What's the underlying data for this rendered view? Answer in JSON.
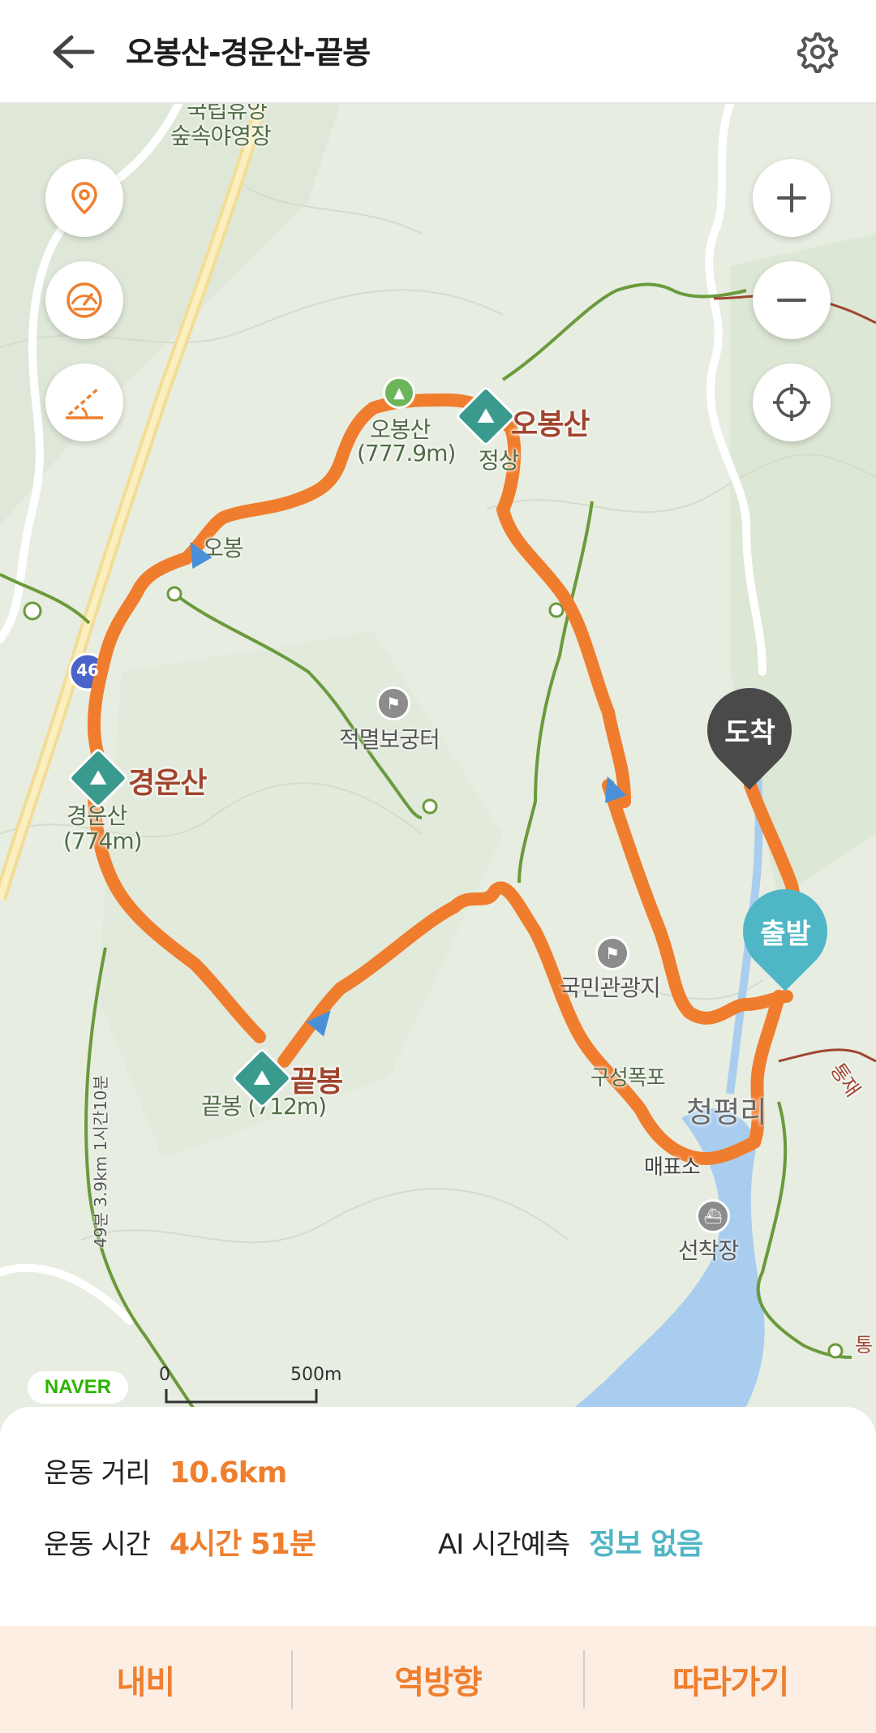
{
  "header": {
    "title": "오봉산-경운산-끝봉",
    "back_icon": "back-arrow-icon",
    "settings_icon": "gear-icon"
  },
  "map": {
    "controls_left": [
      {
        "name": "location-pin-icon"
      },
      {
        "name": "speedometer-icon"
      },
      {
        "name": "elevation-slope-icon"
      }
    ],
    "controls_right": [
      {
        "name": "zoom-in-icon",
        "glyph": "+"
      },
      {
        "name": "zoom-out-icon",
        "glyph": "−"
      },
      {
        "name": "crosshair-icon"
      }
    ],
    "labels": {
      "campsite": "숲속야영장",
      "campsite_top": "국립휴양",
      "obongsan_name": "오봉산",
      "obongsan_alt": "(777.9m)",
      "obongsan_peak": "오봉산",
      "jeongsang": "정상",
      "obong_small": "오봉",
      "jeokmyeol": "적멸보궁터",
      "gyeongunsan_peak": "경운산",
      "gyeongunsan_name": "경운산",
      "gyeongunsan_alt": "(774m)",
      "kkeutbong_peak": "끝봉",
      "kkeutbong_name": "끝봉 (712m)",
      "gukmin": "국민관광지",
      "guseong": "구성폭포",
      "cheongpyeong": "청평리",
      "maepyoso": "매표소",
      "seonchakjang": "선착장",
      "route_46": "46",
      "trail_time": "49분 3.9km 1시간10분",
      "tong_1": "통재",
      "tong_2": "통"
    },
    "markers": {
      "arrival": "도착",
      "departure": "출발"
    },
    "brand": "NAVER",
    "scale_zero": "0",
    "scale_dist": "500m",
    "colors": {
      "route": "#f07d2e",
      "arrival_pin": "#4a4a4a",
      "departure_pin": "#4fb6c5",
      "water": "#a9cdee",
      "trail": "#6a9a3c"
    }
  },
  "info": {
    "distance_label": "운동 거리",
    "distance_value": "10.6km",
    "time_label": "운동 시간",
    "time_value": "4시간 51분",
    "ai_label": "AI 시간예측",
    "ai_value": "정보 없음"
  },
  "bottom_bar": {
    "nav": "내비",
    "reverse": "역방향",
    "follow": "따라가기"
  }
}
